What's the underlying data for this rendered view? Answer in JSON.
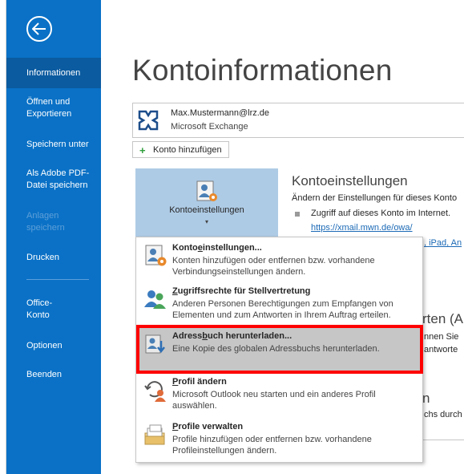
{
  "nav": {
    "items": [
      {
        "label": "Informationen",
        "active": true
      },
      {
        "label": "Öffnen und Exportieren"
      },
      {
        "label": "Speichern unter"
      },
      {
        "label": "Als Adobe PDF-Datei speichern"
      },
      {
        "label": "Anlagen speichern",
        "disabled": true
      },
      {
        "label": "Drucken"
      },
      {
        "label": "Office-Konto"
      },
      {
        "label": "Optionen"
      },
      {
        "label": "Beenden"
      }
    ]
  },
  "page": {
    "title": "Kontoinformationen"
  },
  "account": {
    "email": "Max.Mustermann@lrz.de",
    "type": "Microsoft Exchange",
    "add_label": "Konto hinzufügen"
  },
  "settings": {
    "tile_label": "Kontoeinstellungen",
    "heading": "Kontoeinstellungen",
    "description": "Ändern der Einstellungen für dieses Konto",
    "bullet": "Zugriff auf dieses Konto im Internet.",
    "link": "https://xmail.mwn.de/owa/"
  },
  "background": {
    "frag_ipad": ", iPad, An",
    "frag_heading": "rten (A",
    "frag_line1": "nnen Sie",
    "frag_line2": "antworte",
    "frag_durch": "chs durch"
  },
  "dropdown": {
    "items": [
      {
        "title": "Kontoeinstellungen...",
        "description": "Konten hinzufügen oder entfernen bzw. vorhandene Verbindungseinstellungen ändern."
      },
      {
        "title": "Zugriffsrechte für Stellvertretung",
        "description": "Anderen Personen Berechtigungen zum Empfangen von Elementen und zum Antworten in Ihrem Auftrag erteilen."
      },
      {
        "title": "Adressbuch herunterladen...",
        "description": "Eine Kopie des globalen Adressbuchs herunterladen."
      },
      {
        "title": "Profil ändern",
        "description": "Microsoft Outlook neu starten und ein anderes Profil auswählen."
      },
      {
        "title": "Profile verwalten",
        "description": "Profile hinzufügen oder entfernen bzw. vorhandene Profileinstellungen ändern."
      }
    ]
  },
  "colors": {
    "nav_bg": "#0a71c6",
    "nav_active": "#0b5ba0",
    "tile_bg": "#aecbe5",
    "highlight": "#c6c6c6",
    "annotation": "#ff0000"
  }
}
